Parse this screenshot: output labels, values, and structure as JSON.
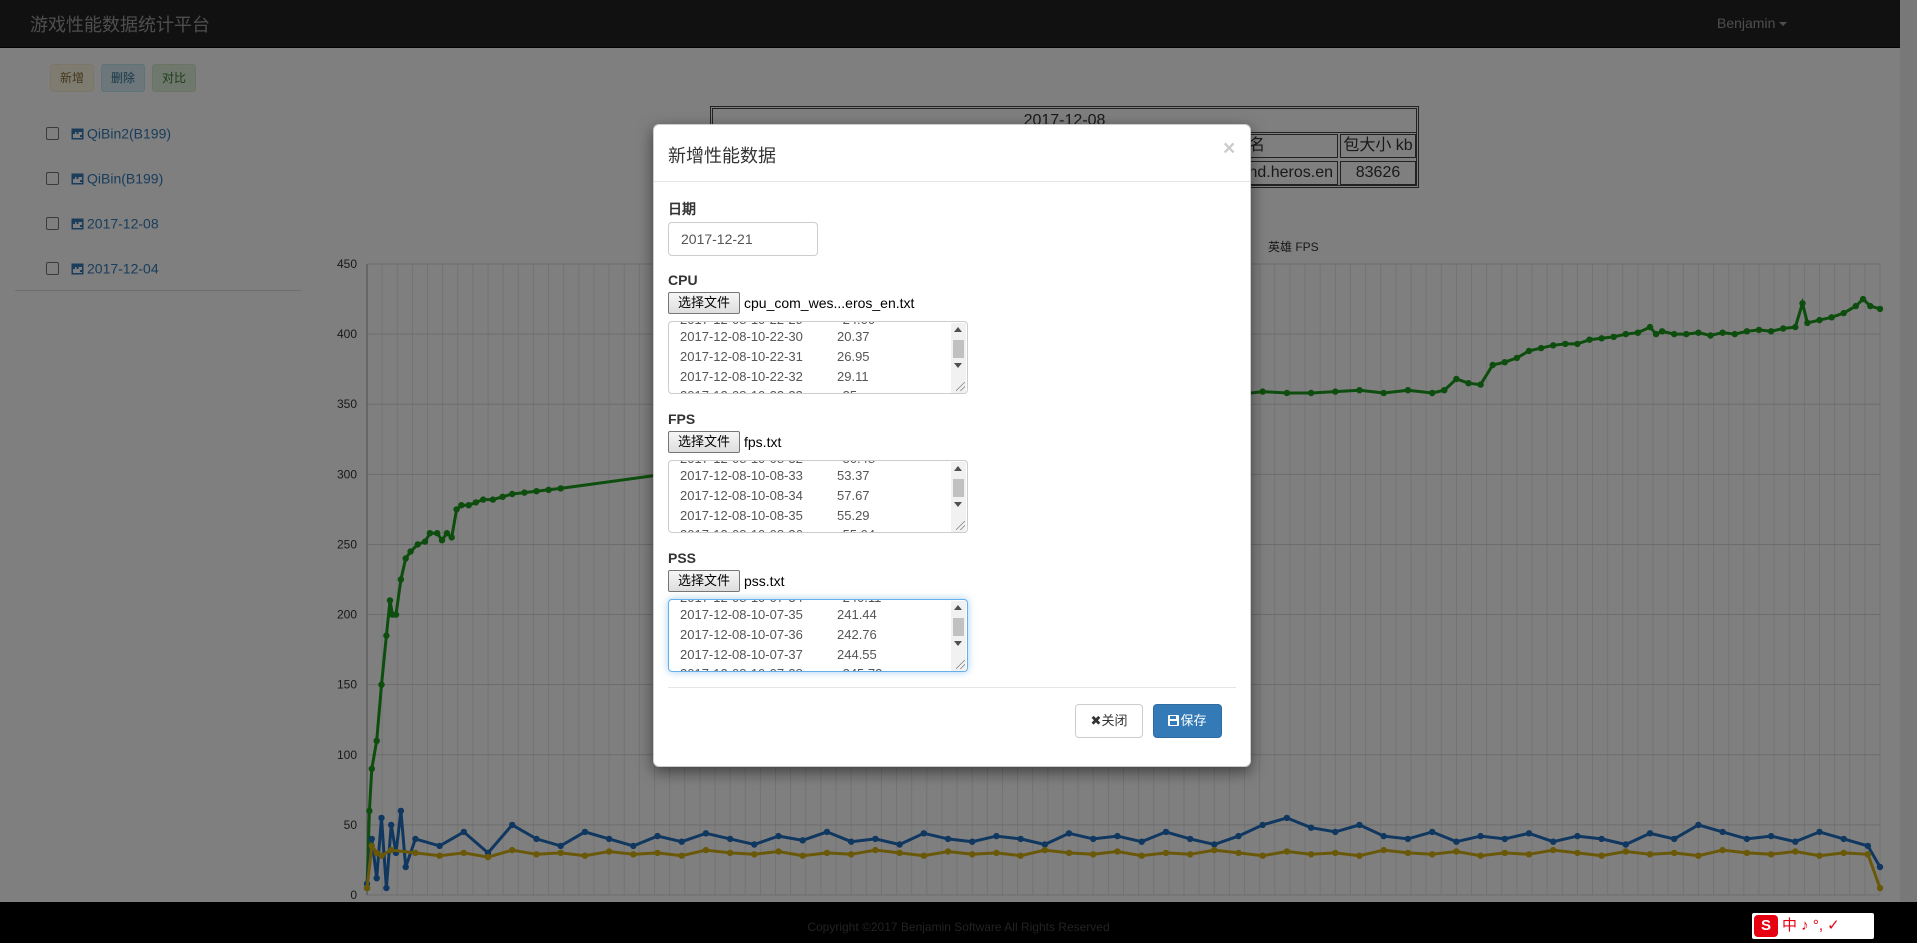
{
  "app": {
    "title": "游戏性能数据统计平台",
    "user": "Benjamin"
  },
  "toolbar": {
    "add": "新增",
    "delete": "删除",
    "compare": "对比"
  },
  "sidebar": {
    "items": [
      {
        "label": "QiBin2(B199)"
      },
      {
        "label": "QiBin(B199)"
      },
      {
        "label": "2017-12-08"
      },
      {
        "label": "2017-12-04"
      }
    ]
  },
  "info_table": {
    "title": "2017-12-08",
    "header_partial": "名",
    "size_header": "包大小 kb",
    "package_partial": "nd.heros.en",
    "size_value": "83626"
  },
  "legend_partial": "英雄 FPS",
  "chart_data": {
    "type": "line",
    "ylim": [
      0,
      450
    ],
    "yticks": [
      0,
      50,
      100,
      150,
      200,
      250,
      300,
      350,
      400,
      450
    ],
    "grid": true,
    "series": [
      {
        "color": "#1a9a1a",
        "points": [
          [
            0,
            5
          ],
          [
            2,
            60
          ],
          [
            4,
            90
          ],
          [
            8,
            110
          ],
          [
            12,
            150
          ],
          [
            16,
            185
          ],
          [
            19,
            210
          ],
          [
            21,
            200
          ],
          [
            24,
            200
          ],
          [
            28,
            225
          ],
          [
            32,
            240
          ],
          [
            36,
            245
          ],
          [
            42,
            250
          ],
          [
            48,
            252
          ],
          [
            52,
            258
          ],
          [
            58,
            258
          ],
          [
            62,
            253
          ],
          [
            66,
            258
          ],
          [
            70,
            255
          ],
          [
            74,
            275
          ],
          [
            78,
            278
          ],
          [
            84,
            278
          ],
          [
            90,
            280
          ],
          [
            96,
            282
          ],
          [
            104,
            282
          ],
          [
            112,
            284
          ],
          [
            120,
            286
          ],
          [
            130,
            287
          ],
          [
            140,
            288
          ],
          [
            150,
            289
          ],
          [
            160,
            290
          ],
          [
            600,
            342
          ],
          [
            620,
            345
          ],
          [
            640,
            350
          ],
          [
            660,
            355
          ],
          [
            680,
            360
          ],
          [
            700,
            358
          ],
          [
            720,
            357
          ],
          [
            740,
            359
          ],
          [
            760,
            358
          ],
          [
            780,
            358
          ],
          [
            800,
            359
          ],
          [
            820,
            360
          ],
          [
            840,
            358
          ],
          [
            860,
            360
          ],
          [
            880,
            358
          ],
          [
            890,
            360
          ],
          [
            900,
            368
          ],
          [
            910,
            365
          ],
          [
            920,
            364
          ],
          [
            930,
            378
          ],
          [
            940,
            380
          ],
          [
            950,
            383
          ],
          [
            960,
            388
          ],
          [
            970,
            390
          ],
          [
            980,
            392
          ],
          [
            990,
            393
          ],
          [
            1000,
            393
          ],
          [
            1010,
            396
          ],
          [
            1020,
            397
          ],
          [
            1030,
            398
          ],
          [
            1040,
            400
          ],
          [
            1050,
            401
          ],
          [
            1060,
            405
          ],
          [
            1065,
            400
          ],
          [
            1070,
            402
          ],
          [
            1080,
            400
          ],
          [
            1090,
            400
          ],
          [
            1100,
            401
          ],
          [
            1110,
            399
          ],
          [
            1120,
            401
          ],
          [
            1130,
            400
          ],
          [
            1140,
            402
          ],
          [
            1150,
            403
          ],
          [
            1160,
            402
          ],
          [
            1170,
            404
          ],
          [
            1180,
            405
          ],
          [
            1186,
            422
          ],
          [
            1190,
            408
          ],
          [
            1200,
            410
          ],
          [
            1210,
            412
          ],
          [
            1220,
            415
          ],
          [
            1230,
            420
          ],
          [
            1236,
            425
          ],
          [
            1242,
            420
          ],
          [
            1250,
            418
          ]
        ]
      },
      {
        "color": "#1f6ebf",
        "points": [
          [
            0,
            8
          ],
          [
            4,
            40
          ],
          [
            8,
            12
          ],
          [
            12,
            55
          ],
          [
            16,
            5
          ],
          [
            20,
            50
          ],
          [
            24,
            30
          ],
          [
            28,
            60
          ],
          [
            32,
            20
          ],
          [
            40,
            40
          ],
          [
            60,
            35
          ],
          [
            80,
            45
          ],
          [
            100,
            30
          ],
          [
            120,
            50
          ],
          [
            140,
            40
          ],
          [
            160,
            35
          ],
          [
            180,
            45
          ],
          [
            200,
            40
          ],
          [
            220,
            35
          ],
          [
            240,
            42
          ],
          [
            260,
            38
          ],
          [
            280,
            44
          ],
          [
            300,
            40
          ],
          [
            320,
            36
          ],
          [
            340,
            42
          ],
          [
            360,
            39
          ],
          [
            380,
            45
          ],
          [
            400,
            38
          ],
          [
            420,
            40
          ],
          [
            440,
            36
          ],
          [
            460,
            44
          ],
          [
            480,
            40
          ],
          [
            500,
            38
          ],
          [
            520,
            42
          ],
          [
            540,
            40
          ],
          [
            560,
            36
          ],
          [
            580,
            44
          ],
          [
            600,
            40
          ],
          [
            620,
            42
          ],
          [
            640,
            38
          ],
          [
            660,
            45
          ],
          [
            680,
            40
          ],
          [
            700,
            36
          ],
          [
            720,
            42
          ],
          [
            740,
            50
          ],
          [
            760,
            55
          ],
          [
            780,
            48
          ],
          [
            800,
            45
          ],
          [
            820,
            50
          ],
          [
            840,
            42
          ],
          [
            860,
            40
          ],
          [
            880,
            45
          ],
          [
            900,
            38
          ],
          [
            920,
            42
          ],
          [
            940,
            40
          ],
          [
            960,
            44
          ],
          [
            980,
            38
          ],
          [
            1000,
            42
          ],
          [
            1020,
            40
          ],
          [
            1040,
            36
          ],
          [
            1060,
            44
          ],
          [
            1080,
            40
          ],
          [
            1100,
            50
          ],
          [
            1120,
            45
          ],
          [
            1140,
            40
          ],
          [
            1160,
            42
          ],
          [
            1180,
            38
          ],
          [
            1200,
            45
          ],
          [
            1220,
            40
          ],
          [
            1240,
            35
          ],
          [
            1250,
            20
          ]
        ]
      },
      {
        "color": "#d4b012",
        "points": [
          [
            0,
            5
          ],
          [
            4,
            35
          ],
          [
            8,
            30
          ],
          [
            12,
            28
          ],
          [
            20,
            32
          ],
          [
            40,
            30
          ],
          [
            60,
            28
          ],
          [
            80,
            30
          ],
          [
            100,
            27
          ],
          [
            120,
            32
          ],
          [
            140,
            29
          ],
          [
            160,
            30
          ],
          [
            180,
            28
          ],
          [
            200,
            31
          ],
          [
            220,
            29
          ],
          [
            240,
            30
          ],
          [
            260,
            28
          ],
          [
            280,
            32
          ],
          [
            300,
            30
          ],
          [
            320,
            29
          ],
          [
            340,
            31
          ],
          [
            360,
            28
          ],
          [
            380,
            30
          ],
          [
            400,
            29
          ],
          [
            420,
            32
          ],
          [
            440,
            30
          ],
          [
            460,
            28
          ],
          [
            480,
            31
          ],
          [
            500,
            29
          ],
          [
            520,
            30
          ],
          [
            540,
            28
          ],
          [
            560,
            32
          ],
          [
            580,
            30
          ],
          [
            600,
            29
          ],
          [
            620,
            31
          ],
          [
            640,
            28
          ],
          [
            660,
            30
          ],
          [
            680,
            29
          ],
          [
            700,
            32
          ],
          [
            720,
            30
          ],
          [
            740,
            28
          ],
          [
            760,
            31
          ],
          [
            780,
            29
          ],
          [
            800,
            30
          ],
          [
            820,
            28
          ],
          [
            840,
            32
          ],
          [
            860,
            30
          ],
          [
            880,
            29
          ],
          [
            900,
            31
          ],
          [
            920,
            28
          ],
          [
            940,
            30
          ],
          [
            960,
            29
          ],
          [
            980,
            32
          ],
          [
            1000,
            30
          ],
          [
            1020,
            28
          ],
          [
            1040,
            31
          ],
          [
            1060,
            29
          ],
          [
            1080,
            30
          ],
          [
            1100,
            28
          ],
          [
            1120,
            32
          ],
          [
            1140,
            30
          ],
          [
            1160,
            29
          ],
          [
            1180,
            31
          ],
          [
            1200,
            28
          ],
          [
            1220,
            30
          ],
          [
            1240,
            29
          ],
          [
            1250,
            5
          ]
        ]
      }
    ]
  },
  "footer": {
    "copyright": "Copyright ©2017 Benjamin Software All Rights Reserved"
  },
  "ime": {
    "logo": "S",
    "text": "中 ♪ °, ✓"
  },
  "modal": {
    "title": "新增性能数据",
    "close_glyph": "×",
    "date_label": "日期",
    "date_value": "2017-12-21",
    "cpu": {
      "label": "CPU",
      "button": "选择文件",
      "file": "cpu_com_wes...eros_en.txt",
      "rows": [
        {
          "time": "2017-12-08-10-22-30",
          "value": "20.37"
        },
        {
          "time": "2017-12-08-10-22-31",
          "value": "26.95"
        },
        {
          "time": "2017-12-08-10-22-32",
          "value": "29.11"
        }
      ]
    },
    "fps": {
      "label": "FPS",
      "button": "选择文件",
      "file": "fps.txt",
      "rows": [
        {
          "time": "2017-12-08-10-08-33",
          "value": "53.37"
        },
        {
          "time": "2017-12-08-10-08-34",
          "value": "57.67"
        },
        {
          "time": "2017-12-08-10-08-35",
          "value": "55.29"
        }
      ]
    },
    "pss": {
      "label": "PSS",
      "button": "选择文件",
      "file": "pss.txt",
      "rows": [
        {
          "time": "2017-12-08-10-07-35",
          "value": "241.44"
        },
        {
          "time": "2017-12-08-10-07-36",
          "value": "242.76"
        },
        {
          "time": "2017-12-08-10-07-37",
          "value": "244.55"
        }
      ]
    },
    "close_button": "关闭",
    "save_button": "保存"
  }
}
